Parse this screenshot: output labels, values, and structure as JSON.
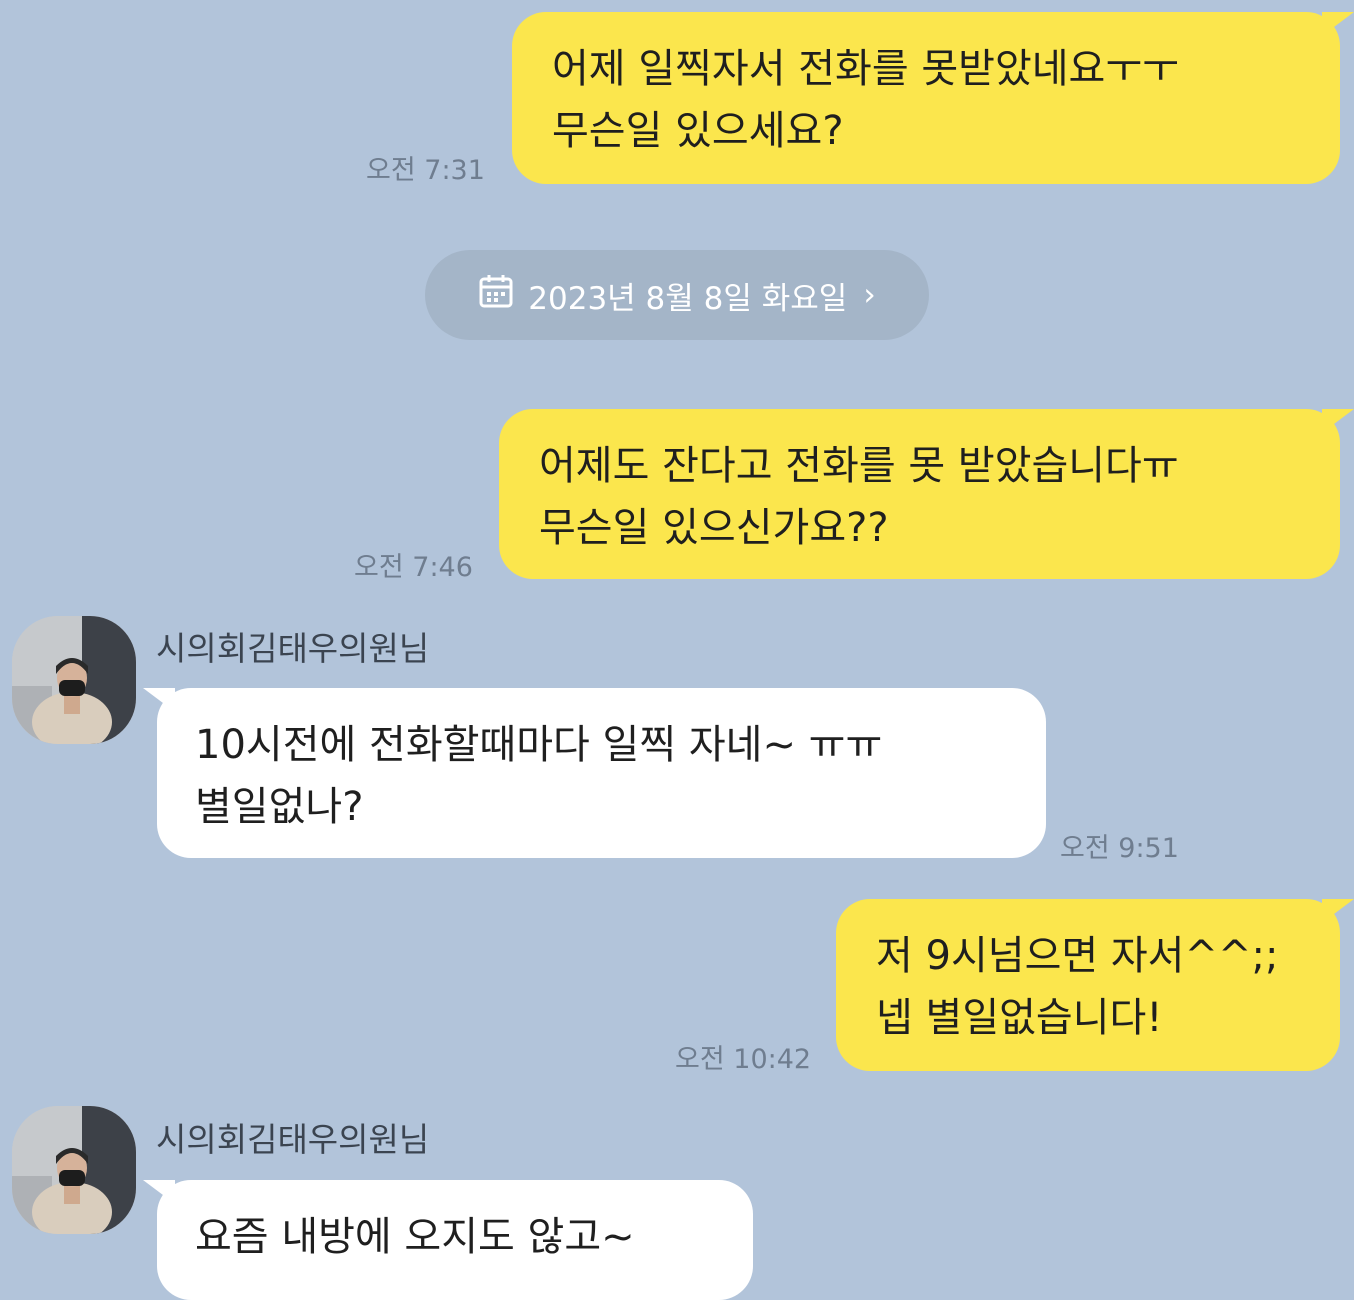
{
  "colors": {
    "background": "#b2c4da",
    "my_bubble": "#fbe64d",
    "their_bubble": "#ffffff",
    "date_pill": "#a4b5c8"
  },
  "date_divider": {
    "icon": "calendar-icon",
    "label": "2023년 8월 8일 화요일",
    "chevron": "›"
  },
  "messages": [
    {
      "from": "me",
      "lines": [
        "어제 일찍자서 전화를 못받았네요ㅜㅜ",
        "무슨일 있으세요?"
      ],
      "time": "오전 7:31"
    },
    {
      "from": "me",
      "lines": [
        "어제도 잔다고 전화를 못 받았습니다ㅠ",
        "무슨일 있으신가요??"
      ],
      "time": "오전 7:46"
    },
    {
      "from": "other",
      "sender": "시의회김태우의원님",
      "lines": [
        "10시전에 전화할때마다 일찍 자네~ ㅠㅠ",
        "별일없나?"
      ],
      "time": "오전 9:51"
    },
    {
      "from": "me",
      "lines": [
        "저 9시넘으면 자서^^;;",
        "넵 별일없습니다!"
      ],
      "time": "오전 10:42"
    },
    {
      "from": "other",
      "sender": "시의회김태우의원님",
      "lines": [
        "요즘 내방에 오지도 않고~"
      ]
    }
  ]
}
